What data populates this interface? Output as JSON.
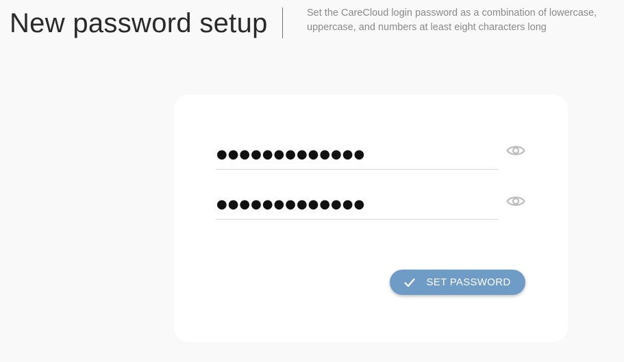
{
  "header": {
    "title": "New password setup",
    "description": "Set the CareCloud login password as a combination of lowercase, uppercase, and numbers at least eight characters long"
  },
  "form": {
    "password": {
      "value": "●●●●●●●●●●●●●",
      "toggle_icon": "eye-icon"
    },
    "confirm_password": {
      "value": "●●●●●●●●●●●●●",
      "toggle_icon": "eye-icon"
    },
    "submit": {
      "label": "SET PASSWORD",
      "icon": "check-icon"
    }
  },
  "colors": {
    "accent": "#6f9cc7",
    "background": "#f9f9f9",
    "card": "#ffffff",
    "title": "#2a2a2a",
    "muted": "#8a8a8a"
  }
}
